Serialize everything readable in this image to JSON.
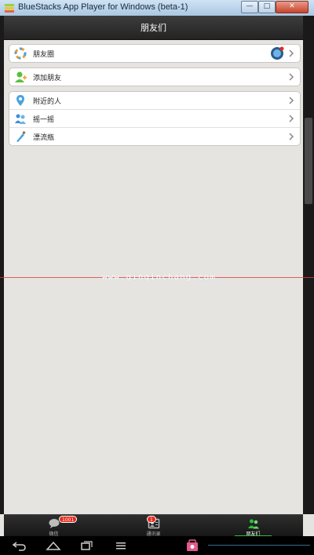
{
  "window": {
    "title": "BlueStacks App Player for Windows (beta-1)",
    "controls": [
      "—",
      "□",
      "✕"
    ]
  },
  "header": {
    "title": "朋友们"
  },
  "groups": [
    {
      "items": [
        {
          "label": "朋友圈",
          "icon": "moments-icon",
          "has_avatar": true
        }
      ]
    },
    {
      "items": [
        {
          "label": "添加朋友",
          "icon": "add-friend-icon"
        }
      ]
    },
    {
      "items": [
        {
          "label": "附近的人",
          "icon": "location-pin-icon"
        },
        {
          "label": "摇一摇",
          "icon": "shake-icon"
        },
        {
          "label": "漂流瓶",
          "icon": "drift-bottle-icon"
        }
      ]
    }
  ],
  "watermark": "www.qinqinchang.com",
  "tabbar": {
    "tabs": [
      {
        "label": "微信",
        "icon": "chat-bubble-icon",
        "badge": "1001"
      },
      {
        "label": "通讯录",
        "icon": "contacts-icon",
        "badge": "1"
      },
      {
        "label": "朋友们",
        "icon": "friends-icon",
        "active": true
      }
    ]
  },
  "colors": {
    "accent": "#2fbf3a",
    "badge": "#e32b1d",
    "header": "#2e2e2e"
  }
}
